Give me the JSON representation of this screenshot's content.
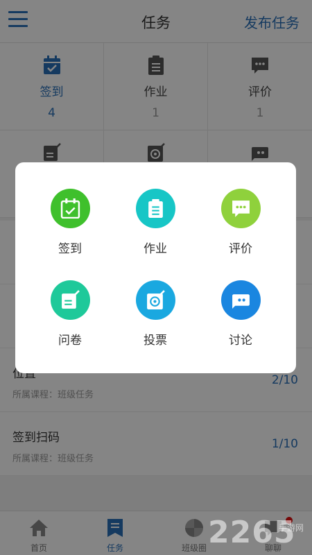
{
  "header": {
    "title": "任务",
    "publish_label": "发布任务"
  },
  "stats": [
    {
      "label": "签到",
      "count": "4",
      "icon": "calendar-check-icon"
    },
    {
      "label": "作业",
      "count": "1",
      "icon": "clipboard-icon"
    },
    {
      "label": "评价",
      "count": "1",
      "icon": "chat-bubble-icon"
    }
  ],
  "list": [
    {
      "title": "",
      "subtitle": "",
      "progress": ""
    },
    {
      "title": "",
      "subtitle": "",
      "progress": ""
    },
    {
      "title": "位置",
      "subtitle": "所属课程：班级任务",
      "progress": "2/10"
    },
    {
      "title": "签到扫码",
      "subtitle": "所属课程：班级任务",
      "progress": "1/10"
    }
  ],
  "nav": [
    {
      "label": "首页",
      "icon": "home-icon"
    },
    {
      "label": "任务",
      "icon": "bookmark-list-icon"
    },
    {
      "label": "班级圈",
      "icon": "pinwheel-icon"
    },
    {
      "label": "聊聊",
      "icon": "chat-icon"
    }
  ],
  "modal": {
    "options": [
      {
        "label": "签到",
        "icon": "calendar-check-icon",
        "color": "#3fc02c"
      },
      {
        "label": "作业",
        "icon": "clipboard-icon",
        "color": "#17c6c6"
      },
      {
        "label": "评价",
        "icon": "chat-bubble-icon",
        "color": "#8fd13c"
      },
      {
        "label": "问卷",
        "icon": "edit-note-icon",
        "color": "#1ec99a"
      },
      {
        "label": "投票",
        "icon": "vote-icon",
        "color": "#1aa8e0"
      },
      {
        "label": "讨论",
        "icon": "discussion-icon",
        "color": "#1a86e0"
      }
    ]
  },
  "colors": {
    "accent": "#2a6fb8",
    "badge": "#e01010"
  },
  "watermark": {
    "main": "2265",
    "sub": "手游网"
  }
}
